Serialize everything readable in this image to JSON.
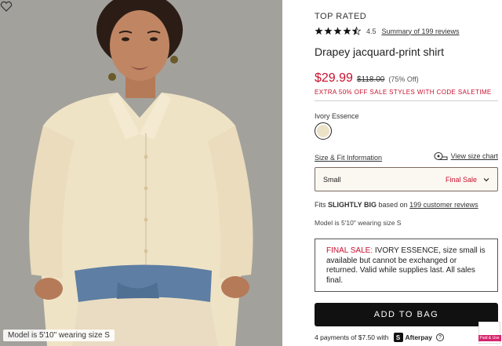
{
  "photo": {
    "caption": "Model is 5'10\" wearing size S"
  },
  "product": {
    "badge": "TOP RATED",
    "rating": "4.5",
    "rating_value": 4.5,
    "review_link": "Summary of 199 reviews",
    "title": "Drapey jacquard-print shirt",
    "price_sale": "$29.99",
    "price_original": "$118.00",
    "price_off": "(75% Off)",
    "promo": "EXTRA 50% OFF SALE STYLES WITH CODE SALETIME",
    "color_name": "Ivory Essence",
    "swatch_color": "#ece2c6"
  },
  "size": {
    "fit_link": "Size & Fit Information",
    "chart_link": "View size chart",
    "selected": "Small",
    "status": "Final Sale"
  },
  "fit": {
    "prefix": "Fits",
    "strong": "SLIGHTLY BIG",
    "middle": "based on",
    "link": "199 customer reviews"
  },
  "model_note": "Model is 5'10\" wearing size S",
  "final_sale": {
    "label": "FINAL SALE:",
    "text": "IVORY ESSENCE, size small is available but cannot be exchanged or returned. Valid while supplies last. All sales final."
  },
  "cta": {
    "add_to_bag": "ADD TO BAG"
  },
  "afterpay": {
    "text": "4 payments of $7.50 with",
    "brand": "Afterpay",
    "info": "?"
  },
  "tag": {
    "label": "Paid & Use"
  },
  "colors": {
    "sale_red": "#c8102e",
    "button_black": "#111111"
  }
}
